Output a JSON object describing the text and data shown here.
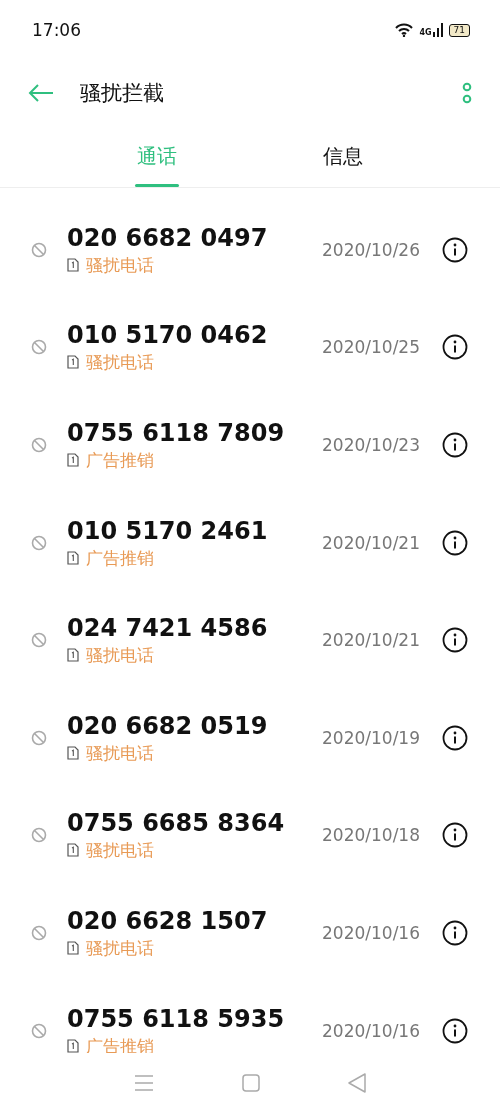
{
  "status_bar": {
    "time": "17:06",
    "network": "4G",
    "battery": "71"
  },
  "header": {
    "title": "骚扰拦截"
  },
  "tabs": [
    {
      "label": "通话",
      "selected": true
    },
    {
      "label": "信息",
      "selected": false
    }
  ],
  "calls": [
    {
      "number": "020 6682 0497",
      "tag": "骚扰电话",
      "date": "2020/10/26"
    },
    {
      "number": "010 5170 0462",
      "tag": "骚扰电话",
      "date": "2020/10/25"
    },
    {
      "number": "0755 6118 7809",
      "tag": "广告推销",
      "date": "2020/10/23"
    },
    {
      "number": "010 5170 2461",
      "tag": "广告推销",
      "date": "2020/10/21"
    },
    {
      "number": "024 7421 4586",
      "tag": "骚扰电话",
      "date": "2020/10/21"
    },
    {
      "number": "020 6682 0519",
      "tag": "骚扰电话",
      "date": "2020/10/19"
    },
    {
      "number": "0755 6685 8364",
      "tag": "骚扰电话",
      "date": "2020/10/18"
    },
    {
      "number": "020 6628 1507",
      "tag": "骚扰电话",
      "date": "2020/10/16"
    },
    {
      "number": "0755 6118 5935",
      "tag": "广告推销",
      "date": "2020/10/16"
    }
  ]
}
